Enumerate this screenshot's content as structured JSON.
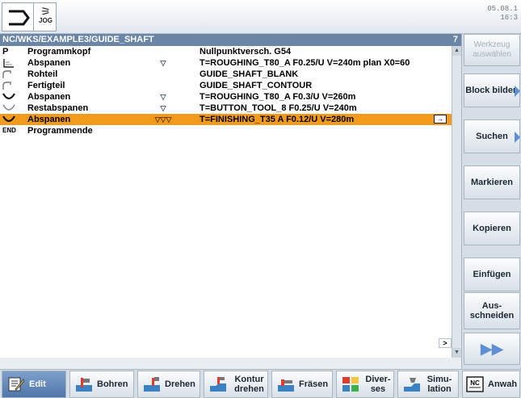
{
  "status_bar": {
    "mode_label": "JOG",
    "clock_line1": "05.08.1",
    "clock_line2": "16:3"
  },
  "program_path": {
    "path": "NC/WKS/EXAMPLE3/GUIDE_SHAFT",
    "number": "7"
  },
  "program_rows": [
    {
      "icon": "p-icon",
      "name": "Programmkopf",
      "marks": "",
      "params": "Nullpunktversch. G54",
      "selected": false
    },
    {
      "icon": "stock-removal-icon",
      "name": "Abspanen",
      "marks": "▽",
      "params": "T=ROUGHING_T80_A F0.25/U V=240m plan X0=60",
      "selected": false
    },
    {
      "icon": "contour-blank-icon",
      "name": "Rohteil",
      "marks": "",
      "params": "GUIDE_SHAFT_BLANK",
      "selected": false
    },
    {
      "icon": "contour-finished-icon",
      "name": "Fertigteil",
      "marks": "",
      "params": "GUIDE_SHAFT_CONTOUR",
      "selected": false
    },
    {
      "icon": "roughing-icon",
      "name": "Abspanen",
      "marks": "▽",
      "params": "T=ROUGHING_T80_A F0.3/U V=260m",
      "selected": false
    },
    {
      "icon": "residual-icon",
      "name": "Restabspanen",
      "marks": "▽",
      "params": "T=BUTTON_TOOL_8 F0.25/U V=240m",
      "selected": false
    },
    {
      "icon": "finishing-icon",
      "name": "Abspanen",
      "marks": "▽▽▽",
      "params": "T=FINISHING_T35 A F0.12/U V=280m",
      "selected": true
    },
    {
      "icon": "end-icon",
      "name": "Programmende",
      "marks": "",
      "params": "",
      "selected": false
    }
  ],
  "end_label": "END",
  "p_label": "P",
  "right_softkeys": {
    "werkzeug": "Werkzeug auswählen",
    "block_bilden": "Block bilden",
    "suchen": "Suchen",
    "markieren": "Markieren",
    "kopieren": "Kopieren",
    "einfuegen": "Einfügen",
    "ausschneiden": "Aus- schneiden"
  },
  "bottom_softkeys": {
    "edit": "Edit",
    "bohren": "Bohren",
    "drehen": "Drehen",
    "kontur_drehen": "Kontur drehen",
    "fraesen": "Fräsen",
    "diverses": "Diver- ses",
    "simulation": "Simu- lation",
    "anwahl": "Anwah"
  },
  "colors": {
    "selection": "#f29a1c",
    "header": "#6a85a6",
    "accent_blue": "#5f8fd3"
  }
}
